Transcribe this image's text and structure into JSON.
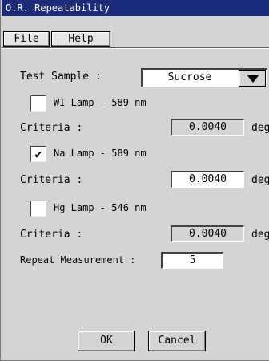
{
  "window": {
    "title": "O.R. Repeatability"
  },
  "menu": {
    "file": "File",
    "help": "Help"
  },
  "test_sample": {
    "label": "Test Sample :",
    "value": "Sucrose"
  },
  "lamps": [
    {
      "label": "WI Lamp - 589 nm",
      "checked": false,
      "check_mark": "",
      "criteria_label": "Criteria :",
      "criteria_value": "0.0040",
      "unit": "deg",
      "enabled": false
    },
    {
      "label": "Na Lamp - 589 nm",
      "checked": true,
      "check_mark": "✔",
      "criteria_label": "Criteria :",
      "criteria_value": "0.0040",
      "unit": "deg",
      "enabled": true
    },
    {
      "label": "Hg Lamp - 546 nm",
      "checked": false,
      "check_mark": "",
      "criteria_label": "Criteria :",
      "criteria_value": "0.0040",
      "unit": "deg",
      "enabled": false
    }
  ],
  "repeat": {
    "label": "Repeat Measurement :",
    "value": "5"
  },
  "buttons": {
    "ok": "OK",
    "cancel": "Cancel"
  }
}
